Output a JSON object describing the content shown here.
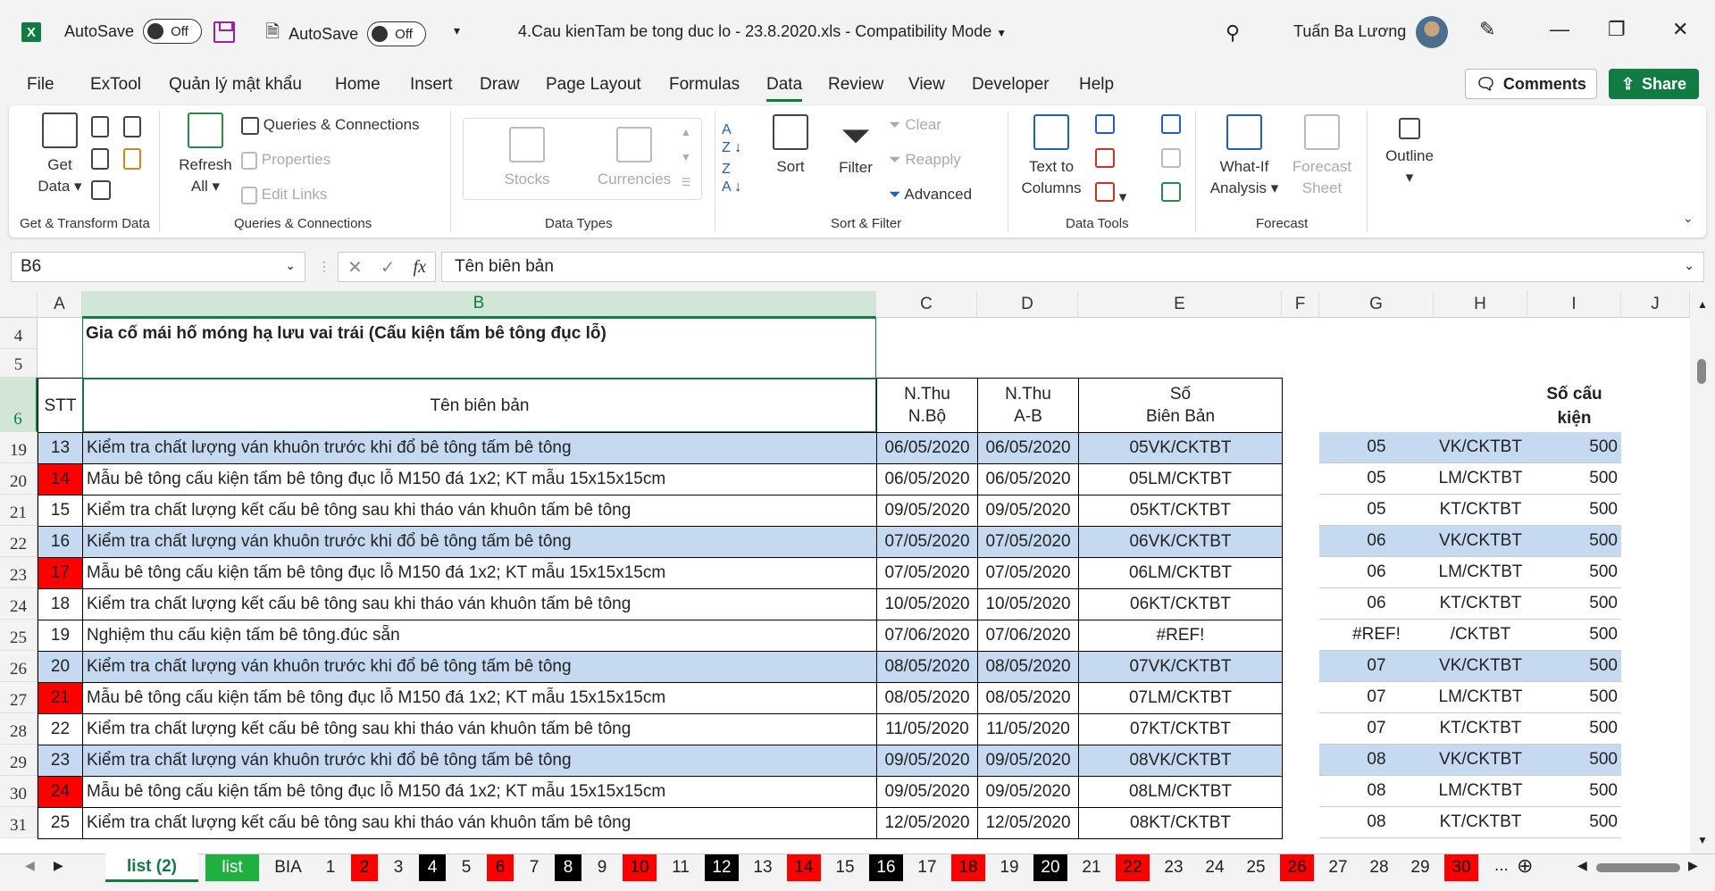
{
  "titlebar": {
    "autosave1": "AutoSave",
    "autosave2": "AutoSave",
    "toggle": "Off",
    "title": "4.Cau kienTam be tong duc lo - 23.8.2020.xls  -  Compatibility Mode",
    "user": "Tuấn Ba Lương"
  },
  "tabs": [
    "File",
    "ExTool",
    "Quản lý mật khẩu",
    "Home",
    "Insert",
    "Draw",
    "Page Layout",
    "Formulas",
    "Data",
    "Review",
    "View",
    "Developer",
    "Help"
  ],
  "buttons": {
    "comments": "Comments",
    "share": "Share"
  },
  "ribbon": {
    "get_data": [
      "Get",
      "Data"
    ],
    "refresh": [
      "Refresh",
      "All"
    ],
    "queries_connections": "Queries & Connections",
    "properties": "Properties",
    "edit_links": "Edit Links",
    "stocks": "Stocks",
    "currencies": "Currencies",
    "sort": "Sort",
    "filter": "Filter",
    "clear": "Clear",
    "reapply": "Reapply",
    "advanced": "Advanced",
    "text_to_columns": [
      "Text to",
      "Columns"
    ],
    "what_if": [
      "What-If",
      "Analysis"
    ],
    "forecast_sheet": [
      "Forecast",
      "Sheet"
    ],
    "outline": "Outline",
    "groups": [
      "Get & Transform Data",
      "Queries & Connections",
      "Data Types",
      "Sort & Filter",
      "Data Tools",
      "Forecast"
    ]
  },
  "formula": {
    "namebox": "B6",
    "content": "Tên biên bản"
  },
  "columns": [
    "A",
    "B",
    "C",
    "D",
    "E",
    "F",
    "G",
    "H",
    "I",
    "J"
  ],
  "sheet": {
    "title": "Gia cố mái hố móng hạ lưu vai trái (Cấu kiện tấm bê tông đục lỗ)",
    "headers": {
      "stt": "STT",
      "ten": "Tên biên bản",
      "nthu1": [
        "N.Thu",
        "N.Bộ"
      ],
      "nthu2": [
        "N.Thu",
        "A-B"
      ],
      "so": [
        "Số",
        "Biên Bản"
      ],
      "socaukien": [
        "Số cấu",
        "kiện"
      ]
    },
    "rows": [
      {
        "r": "19",
        "stt": "13",
        "name": "Kiểm tra chất lượng ván khuôn trước khi đổ bê tông tấm bê tông",
        "c": "06/05/2020",
        "d": "06/05/2020",
        "e": "05VK/CKTBT",
        "g": "05",
        "h": "VK/CKTBT",
        "i": "500",
        "style": "blue"
      },
      {
        "r": "20",
        "stt": "14",
        "name": "Mẫu bê tông cấu kiện tấm bê tông đục lỗ M150 đá 1x2; KT mẫu 15x15x15cm",
        "c": "06/05/2020",
        "d": "06/05/2020",
        "e": "05LM/CKTBT",
        "g": "05",
        "h": "LM/CKTBT",
        "i": "500",
        "style": "red"
      },
      {
        "r": "21",
        "stt": "15",
        "name": "Kiểm tra chất lượng kết cấu bê tông sau khi tháo ván khuôn tấm bê tông",
        "c": "09/05/2020",
        "d": "09/05/2020",
        "e": "05KT/CKTBT",
        "g": "05",
        "h": "KT/CKTBT",
        "i": "500",
        "style": "plain"
      },
      {
        "r": "22",
        "stt": "16",
        "name": "Kiểm tra chất lượng ván khuôn trước khi đổ bê tông tấm bê tông",
        "c": "07/05/2020",
        "d": "07/05/2020",
        "e": "06VK/CKTBT",
        "g": "06",
        "h": "VK/CKTBT",
        "i": "500",
        "style": "blue"
      },
      {
        "r": "23",
        "stt": "17",
        "name": "Mẫu bê tông cấu kiện tấm bê tông đục lỗ M150 đá 1x2; KT mẫu 15x15x15cm",
        "c": "07/05/2020",
        "d": "07/05/2020",
        "e": "06LM/CKTBT",
        "g": "06",
        "h": "LM/CKTBT",
        "i": "500",
        "style": "red"
      },
      {
        "r": "24",
        "stt": "18",
        "name": "Kiểm tra chất lượng kết cấu bê tông sau khi tháo ván khuôn tấm bê tông",
        "c": "10/05/2020",
        "d": "10/05/2020",
        "e": "06KT/CKTBT",
        "g": "06",
        "h": "KT/CKTBT",
        "i": "500",
        "style": "plain"
      },
      {
        "r": "25",
        "stt": "19",
        "name": "Nghiệm thu cấu kiện tấm bê tông.đúc sẵn",
        "c": "07/06/2020",
        "d": "07/06/2020",
        "e": "#REF!",
        "g": "#REF!",
        "h": "/CKTBT",
        "i": "500",
        "style": "plain"
      },
      {
        "r": "26",
        "stt": "20",
        "name": "Kiểm tra chất lượng ván khuôn trước khi đổ bê tông tấm bê tông",
        "c": "08/05/2020",
        "d": "08/05/2020",
        "e": "07VK/CKTBT",
        "g": "07",
        "h": "VK/CKTBT",
        "i": "500",
        "style": "blue"
      },
      {
        "r": "27",
        "stt": "21",
        "name": "Mẫu bê tông cấu kiện tấm bê tông đục lỗ M150 đá 1x2; KT mẫu 15x15x15cm",
        "c": "08/05/2020",
        "d": "08/05/2020",
        "e": "07LM/CKTBT",
        "g": "07",
        "h": "LM/CKTBT",
        "i": "500",
        "style": "red"
      },
      {
        "r": "28",
        "stt": "22",
        "name": "Kiểm tra chất lượng kết cấu bê tông sau khi tháo ván khuôn tấm bê tông",
        "c": "11/05/2020",
        "d": "11/05/2020",
        "e": "07KT/CKTBT",
        "g": "07",
        "h": "KT/CKTBT",
        "i": "500",
        "style": "plain"
      },
      {
        "r": "29",
        "stt": "23",
        "name": "Kiểm tra chất lượng ván khuôn trước khi đổ bê tông tấm bê tông",
        "c": "09/05/2020",
        "d": "09/05/2020",
        "e": "08VK/CKTBT",
        "g": "08",
        "h": "VK/CKTBT",
        "i": "500",
        "style": "blue"
      },
      {
        "r": "30",
        "stt": "24",
        "name": "Mẫu bê tông cấu kiện tấm bê tông đục lỗ M150 đá 1x2; KT mẫu 15x15x15cm",
        "c": "09/05/2020",
        "d": "09/05/2020",
        "e": "08LM/CKTBT",
        "g": "08",
        "h": "LM/CKTBT",
        "i": "500",
        "style": "red"
      },
      {
        "r": "31",
        "stt": "25",
        "name": "Kiểm tra chất lượng kết cấu bê tông sau khi tháo ván khuôn tấm bê tông",
        "c": "12/05/2020",
        "d": "12/05/2020",
        "e": "08KT/CKTBT",
        "g": "08",
        "h": "KT/CKTBT",
        "i": "500",
        "style": "plain"
      }
    ]
  },
  "sheet_tabs": [
    {
      "label": "list (2)",
      "style": "active"
    },
    {
      "label": "list",
      "style": "green"
    },
    {
      "label": "BIA",
      "style": "plain"
    },
    {
      "label": "1",
      "style": "plain"
    },
    {
      "label": "2",
      "style": "red"
    },
    {
      "label": "3",
      "style": "plain"
    },
    {
      "label": "4",
      "style": "black"
    },
    {
      "label": "5",
      "style": "plain"
    },
    {
      "label": "6",
      "style": "red"
    },
    {
      "label": "7",
      "style": "plain"
    },
    {
      "label": "8",
      "style": "black"
    },
    {
      "label": "9",
      "style": "plain"
    },
    {
      "label": "10",
      "style": "red"
    },
    {
      "label": "11",
      "style": "plain"
    },
    {
      "label": "12",
      "style": "black"
    },
    {
      "label": "13",
      "style": "plain"
    },
    {
      "label": "14",
      "style": "red"
    },
    {
      "label": "15",
      "style": "plain"
    },
    {
      "label": "16",
      "style": "black"
    },
    {
      "label": "17",
      "style": "plain"
    },
    {
      "label": "18",
      "style": "red"
    },
    {
      "label": "19",
      "style": "plain"
    },
    {
      "label": "20",
      "style": "black"
    },
    {
      "label": "21",
      "style": "plain"
    },
    {
      "label": "22",
      "style": "red"
    },
    {
      "label": "23",
      "style": "plain"
    },
    {
      "label": "24",
      "style": "plain"
    },
    {
      "label": "25",
      "style": "plain"
    },
    {
      "label": "26",
      "style": "red"
    },
    {
      "label": "27",
      "style": "plain"
    },
    {
      "label": "28",
      "style": "plain"
    },
    {
      "label": "29",
      "style": "plain"
    },
    {
      "label": "30",
      "style": "red"
    }
  ],
  "more_tabs": "...",
  "colors": {
    "accent": "#107c41",
    "row_blue": "#c5d9f1",
    "stt_red": "#ff0000"
  }
}
